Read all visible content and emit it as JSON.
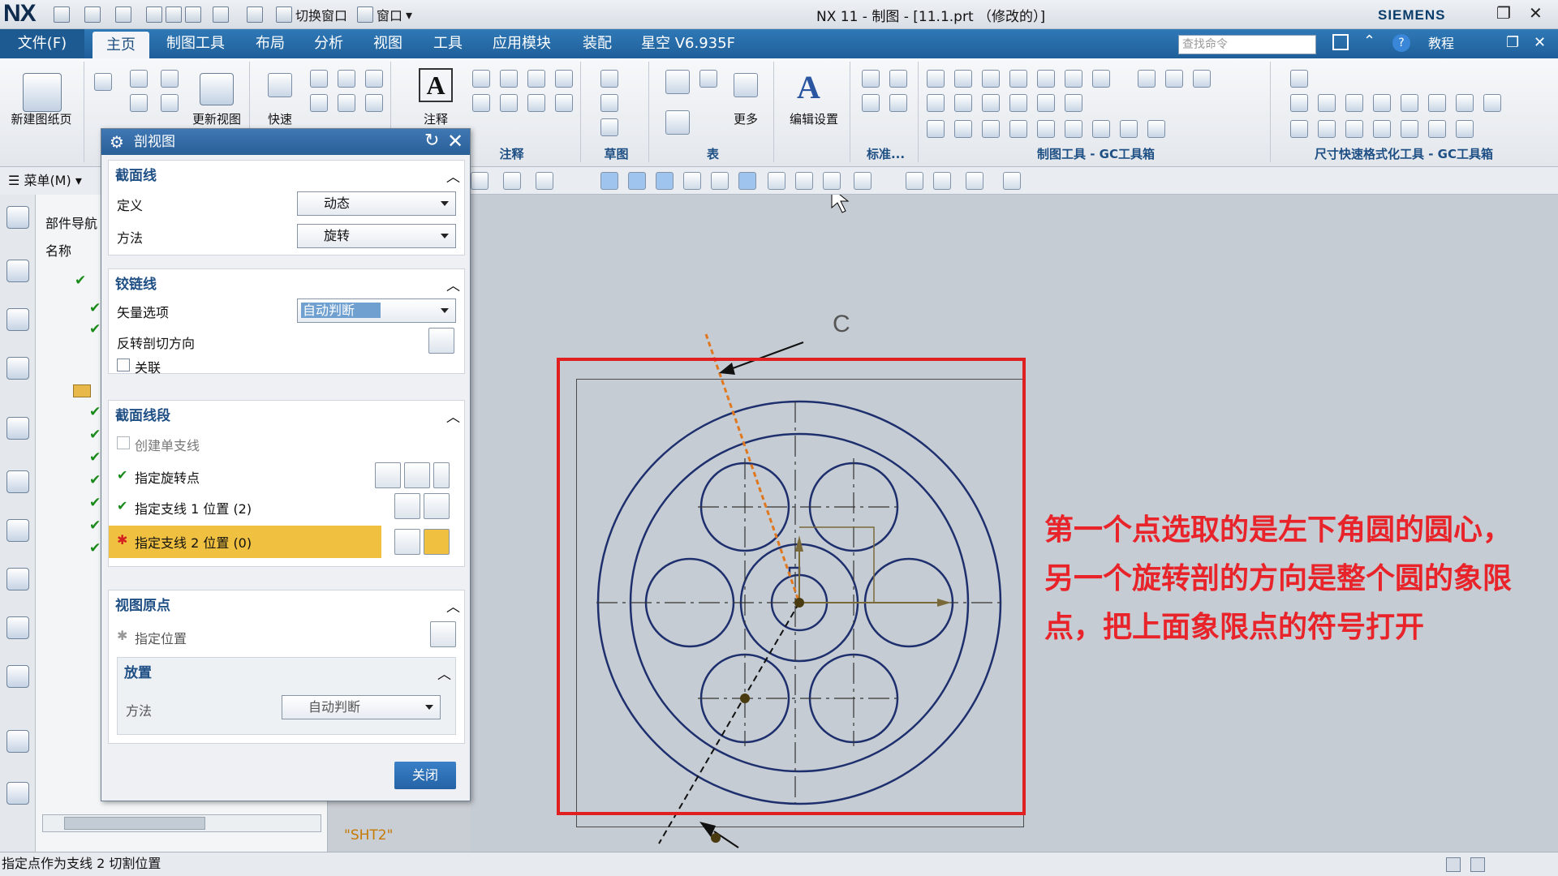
{
  "titlebar": {
    "logo": "NX",
    "title": "NX 11 - 制图 - [11.1.prt （修改的）]",
    "brand": "SIEMENS",
    "switch_window": "切换窗口",
    "window": "窗口"
  },
  "menubar": {
    "file": "文件(F)",
    "tabs": [
      "主页",
      "制图工具",
      "布局",
      "分析",
      "视图",
      "工具",
      "应用模块",
      "装配",
      "星空 V6.935F"
    ],
    "search_placeholder": "查找命令",
    "tutorial": "教程"
  },
  "ribbon": {
    "new_sheet": "新建图纸页",
    "update_view": "更新视图",
    "quick": "快速",
    "annotation": "注释",
    "more": "更多",
    "edit_settings": "编辑设置",
    "groups": [
      "注释",
      "草图",
      "表",
      "标准...",
      "制图工具 - GC工具箱",
      "尺寸快速格式化工具 - GC工具箱"
    ]
  },
  "toolbar": {
    "menu_button": "菜单(M)"
  },
  "navigator": {
    "title": "部件导航",
    "column": "名称"
  },
  "dialog": {
    "title": "剖视图",
    "sections": {
      "section_line": {
        "title": "截面线",
        "define_label": "定义",
        "define_value": "动态",
        "method_label": "方法",
        "method_value": "旋转"
      },
      "hinge_line": {
        "title": "铰链线",
        "vector_label": "矢量选项",
        "vector_value": "自动判断",
        "reverse_label": "反转剖切方向",
        "associative_label": "关联"
      },
      "segments": {
        "title": "截面线段",
        "single_branch": "创建单支线",
        "rotation_point": "指定旋转点",
        "branch1": "指定支线 1 位置 (2)",
        "branch2": "指定支线 2 位置 (0)"
      },
      "view_origin": {
        "title": "视图原点",
        "specify_location": "指定位置",
        "placement_title": "放置",
        "method_label": "方法",
        "method_value": "自动判断"
      }
    },
    "close": "关闭"
  },
  "canvas": {
    "label_c": "C",
    "sheet_name": "\"SHT2\"",
    "annotation_lines": [
      "第一个点选取的是左下角圆的圆心，",
      "另一个旋转剖的方向是整个圆的象限",
      "点，把上面象限点的符号打开"
    ]
  },
  "status": {
    "message": "指定点作为支线 2 切割位置"
  },
  "colors": {
    "accent": "#2a66a8",
    "drawing": "#1e2f6e",
    "annotation": "#e8232a",
    "highlight": "#f0c040"
  }
}
